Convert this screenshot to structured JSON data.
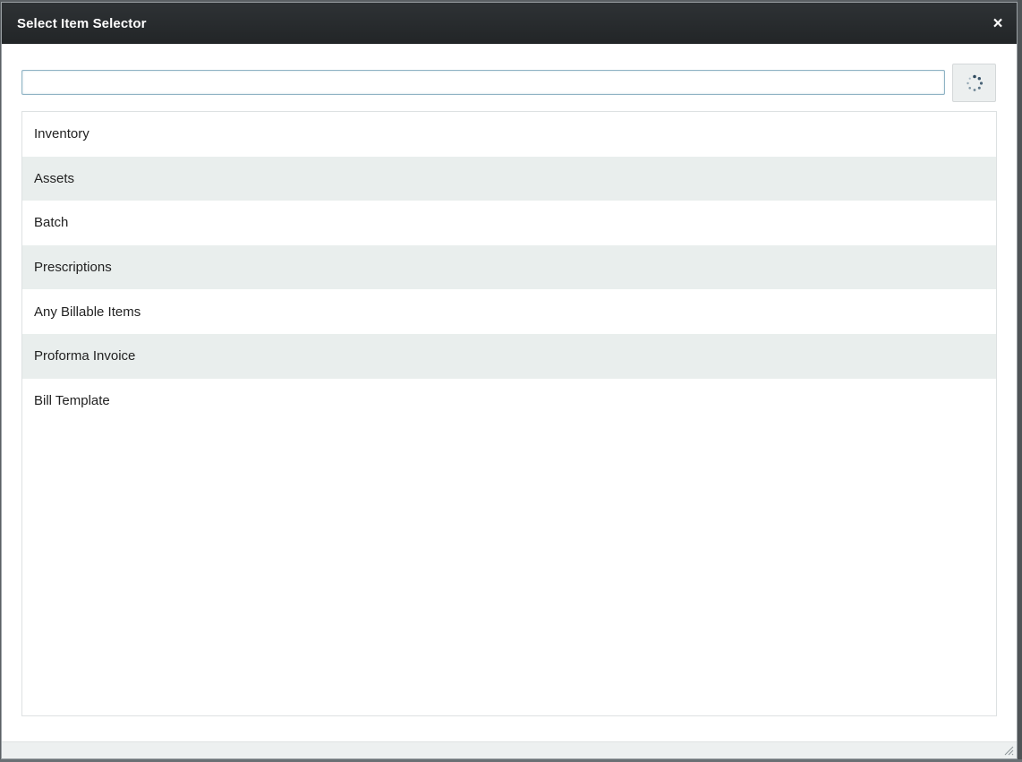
{
  "dialog": {
    "title": "Select Item Selector",
    "close_glyph": "×",
    "close_icon": "close-icon"
  },
  "search": {
    "value": "",
    "placeholder": "",
    "button_icon": "loading-spinner-icon"
  },
  "items": [
    {
      "label": "Inventory"
    },
    {
      "label": "Assets"
    },
    {
      "label": "Batch"
    },
    {
      "label": "Prescriptions"
    },
    {
      "label": "Any Billable Items"
    },
    {
      "label": "Proforma Invoice"
    },
    {
      "label": "Bill Template"
    }
  ],
  "colors": {
    "titlebar": "#2a2d30",
    "row_alt": "#e9eeed",
    "input_border": "#8fb3c4"
  }
}
